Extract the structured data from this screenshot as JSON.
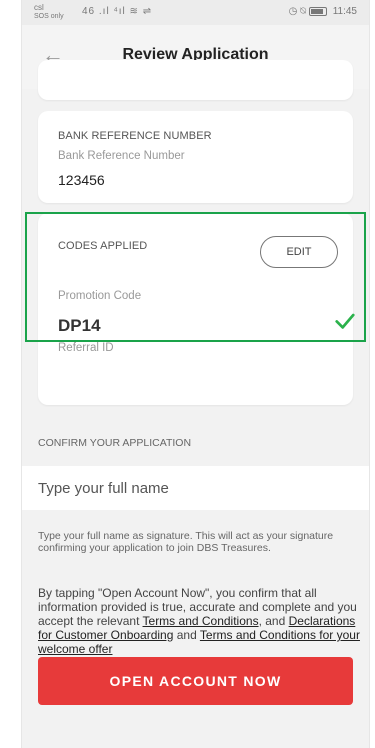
{
  "statusbar": {
    "carrier": "csl",
    "sos": "SOS only",
    "signal": "46 .ıl ⁴ıl ≋ ⇌",
    "icons": "◷ ⍉",
    "time": "11:45"
  },
  "header": {
    "title": "Review Application",
    "back_icon": "←"
  },
  "bank_card": {
    "heading": "BANK REFERENCE NUMBER",
    "sub_label": "Bank Reference Number",
    "value": "123456"
  },
  "codes_card": {
    "heading": "CODES APPLIED",
    "edit_label": "EDIT",
    "promotion_label": "Promotion Code",
    "promotion_value": "DP14",
    "referral_label": "Referral ID",
    "referral_value": ""
  },
  "confirm": {
    "heading": "CONFIRM YOUR APPLICATION",
    "name_placeholder": "Type your full name",
    "hint": "Type your full name as signature. This will act as your signature confirming your application to join DBS Treasures."
  },
  "terms": {
    "prefix": "By tapping \"Open Account Now\", you confirm that all information provided is true, accurate and complete and you accept the relevant ",
    "link1": "Terms and Conditions",
    "mid": ", and ",
    "link2": "Declarations for Customer Onboarding",
    "and": " and ",
    "link3": "Terms and Conditions for your welcome offer"
  },
  "cta": {
    "label": "OPEN ACCOUNT NOW"
  },
  "colors": {
    "accent": "#e73a3a",
    "highlight": "#1aa34a",
    "check": "#2bb24c"
  }
}
